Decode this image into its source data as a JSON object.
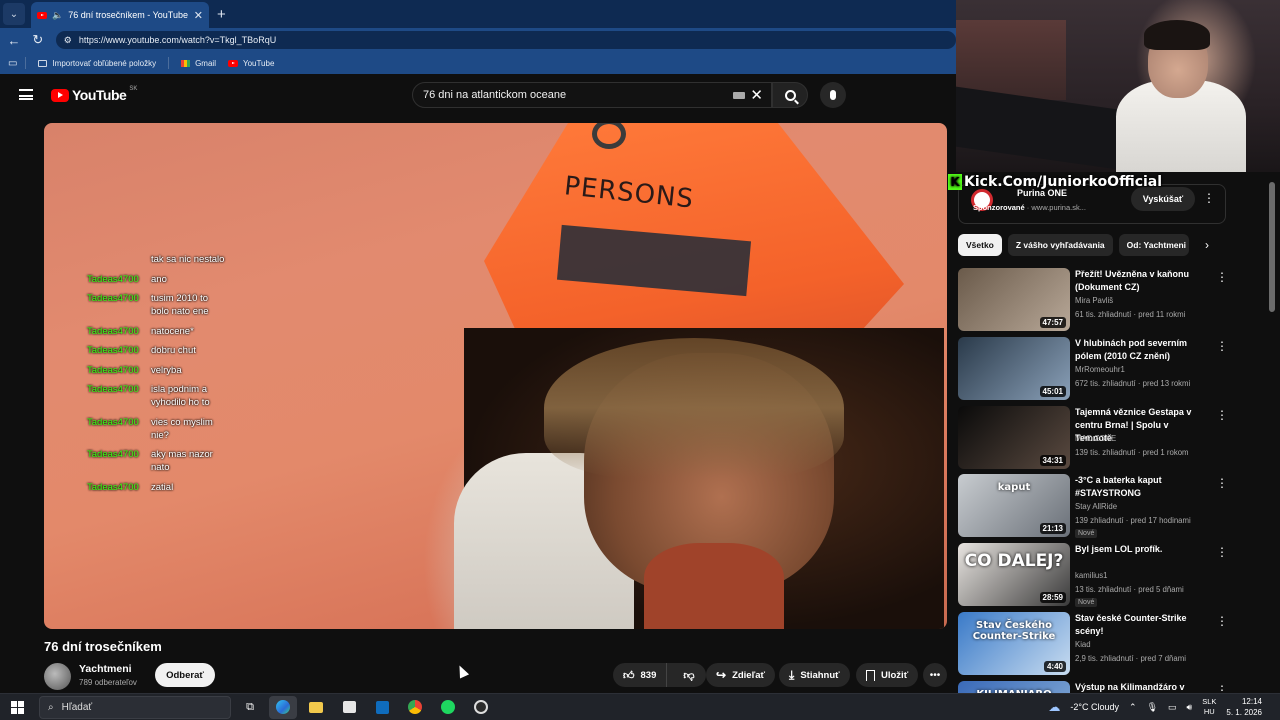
{
  "browser": {
    "tab_title": "76 dní trosečníkem - YouTube",
    "url": "https://www.youtube.com/watch?v=Tkgl_TBoRqU",
    "bookmarks": [
      "Importovať obľúbené položky",
      "Gmail",
      "YouTube"
    ]
  },
  "youtube": {
    "logo": "YouTube",
    "country": "SK",
    "search_value": "76 dni na atlantickom oceane"
  },
  "video": {
    "title": "76 dní trosečníkem",
    "tent_text": "PERSONS",
    "channel": "Yachtmeni",
    "subscribers": "789 odberateľov",
    "subscribe_label": "Odberať",
    "like_count": "839",
    "share_label": "Zdieľať",
    "download_label": "Stiahnuť",
    "save_label": "Uložiť"
  },
  "chat": [
    {
      "user": "",
      "msg": "tak sa nic nestalo"
    },
    {
      "user": "Tadeas4700",
      "msg": "ano"
    },
    {
      "user": "Tadeas4700",
      "msg": "tusim 2010 to bolo nato ene"
    },
    {
      "user": "Tadeas4700",
      "msg": "natocene*"
    },
    {
      "user": "Tadeas4700",
      "msg": "dobru chut"
    },
    {
      "user": "Tadeas4700",
      "msg": "velryba"
    },
    {
      "user": "Tadeas4700",
      "msg": "isla podnim a vyhodilo ho to"
    },
    {
      "user": "Tadeas4700",
      "msg": "vies co myslim nie?"
    },
    {
      "user": "Tadeas4700",
      "msg": "aky mas nazor nato"
    },
    {
      "user": "Tadeas4700",
      "msg": "zatial"
    }
  ],
  "overlay": {
    "kick_text": "Kick.Com/JuniorkoOfficial"
  },
  "ad": {
    "name": "Purina ONE",
    "sponsored": "Sponzorované",
    "domain": "www.purina.sk...",
    "cta": "Vyskúšať"
  },
  "chips": [
    "Všetko",
    "Z vášho vyhľadávania",
    "Od: Yachtmeni"
  ],
  "recommendations": [
    {
      "title": "Přežít! Uvězněna v kaňonu (Dokument CZ)",
      "channel": "Mira Pavliš",
      "meta": "61 tis. zhliadnutí · pred 11 rokmi",
      "duration": "47:57",
      "is_new": "",
      "colors": [
        "#6a5a4a",
        "#b8a898"
      ]
    },
    {
      "title": "V hlubinách pod severním pólem  (2010 CZ znění)",
      "channel": "MrRomeouhr1",
      "meta": "672 tis. zhliadnutí · pred 13 rokmi",
      "duration": "45:01",
      "is_new": "",
      "colors": [
        "#2a3a4a",
        "#8aa0b8"
      ]
    },
    {
      "title": "Tajemná věznice Gestapa v centru Brna! | Spolu v Temnotě",
      "channel": "MAD ZONE",
      "meta": "139 tis. zhliadnutí · pred 1 rokom",
      "duration": "34:31",
      "is_new": "",
      "colors": [
        "#0a0a0a",
        "#5a4a40"
      ]
    },
    {
      "title": "-3°C a baterka kaput #STAYSTRONG",
      "channel": "Stay AllRide",
      "meta": "139 zhliadnutí · pred 17 hodinami",
      "duration": "21:13",
      "is_new": "Nové",
      "colors": [
        "#c8ccd0",
        "#6a7078"
      ]
    },
    {
      "title": "Byl jsem LOL profík.",
      "channel": "kamilius1",
      "meta": "13 tis. zhliadnutí · pred 5 dňami",
      "duration": "28:59",
      "is_new": "Nové",
      "colors": [
        "#e8e4e0",
        "#3a3a3a"
      ]
    },
    {
      "title": "Stav české Counter-Strike scény!",
      "channel": "Kiad",
      "meta": "2,9 tis. zhliadnutí · pred 7 dňami",
      "duration": "4:40",
      "is_new": "",
      "colors": [
        "#3a7ac8",
        "#c8dcf0"
      ]
    },
    {
      "title": "Výstup na Kilimandžáro v",
      "channel": "",
      "meta": "",
      "duration": "",
      "is_new": "",
      "colors": [
        "#3a6ab8",
        "#8ab0d8"
      ]
    }
  ],
  "rec_thumb_text": {
    "r3": "kaput",
    "r4": "CO DALEJ?",
    "r5": "Stav Českého Counter-Strike",
    "r6": "KILIMANJARO"
  },
  "taskbar": {
    "search_placeholder": "Hľadať",
    "weather": "-2°C  Cloudy",
    "lang_top": "SLK",
    "lang_bottom": "HU",
    "time": "12:14",
    "date": "5. 1. 2026"
  }
}
